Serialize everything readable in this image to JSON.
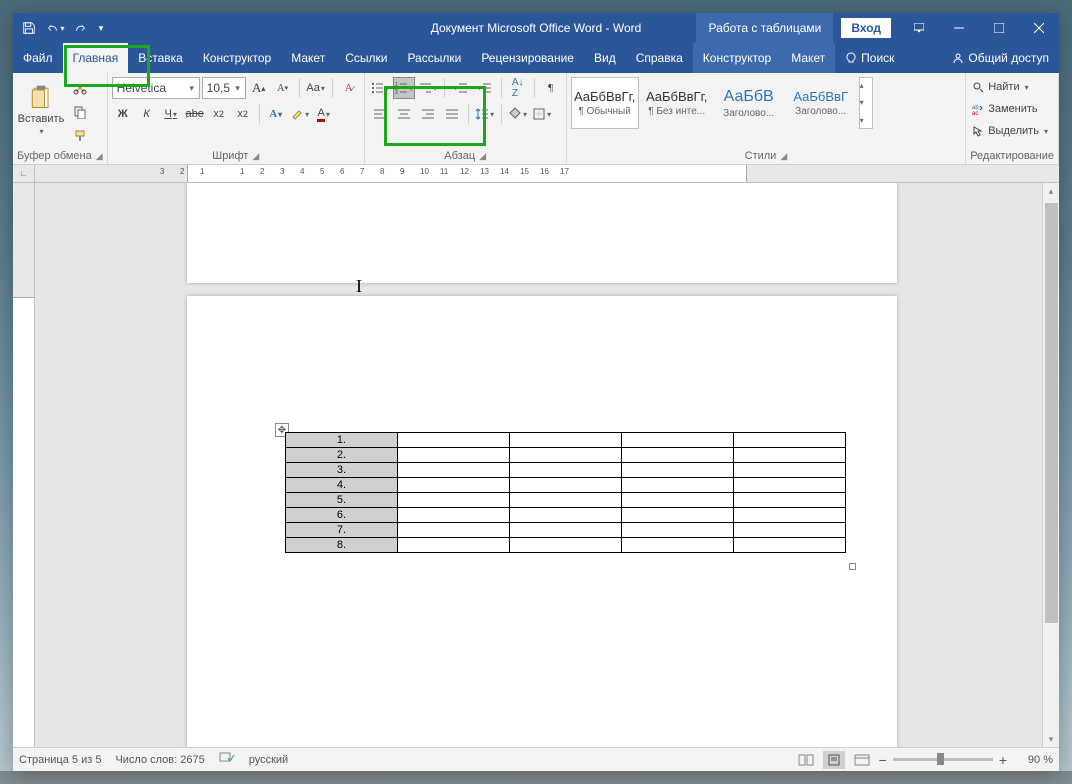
{
  "title": "Документ Microsoft Office Word  -  Word",
  "table_tools": "Работа с таблицами",
  "signin": "Вход",
  "tabs": {
    "file": "Файл",
    "home": "Главная",
    "insert": "Вставка",
    "design": "Конструктор",
    "layout": "Макет",
    "references": "Ссылки",
    "mailings": "Рассылки",
    "review": "Рецензирование",
    "view": "Вид",
    "help": "Справка",
    "ctx_design": "Конструктор",
    "ctx_layout": "Макет",
    "search": "Поиск",
    "share": "Общий доступ"
  },
  "clipboard": {
    "paste": "Вставить",
    "group": "Буфер обмена"
  },
  "font": {
    "name": "Helvetica",
    "size": "10,5",
    "group": "Шрифт",
    "bold": "Ж",
    "italic": "К",
    "underline": "Ч",
    "strike": "abe",
    "caseBtn": "Aa"
  },
  "paragraph": {
    "group": "Абзац"
  },
  "styles": {
    "group": "Стили",
    "preview": "АаБбВвГг,",
    "preview2": "АаБбВ",
    "preview3": "АаБбВвГ",
    "s1": "¶ Обычный",
    "s2": "¶ Без инте...",
    "s3": "Заголово...",
    "s4": "Заголово..."
  },
  "editing": {
    "group": "Редактирование",
    "find": "Найти",
    "replace": "Заменить",
    "select": "Выделить"
  },
  "table": {
    "rows": [
      "1.",
      "2.",
      "3.",
      "4.",
      "5.",
      "6.",
      "7.",
      "8."
    ]
  },
  "status": {
    "page": "Страница 5 из 5",
    "words": "Число слов: 2675",
    "lang": "русский",
    "zoom": "90 %"
  }
}
